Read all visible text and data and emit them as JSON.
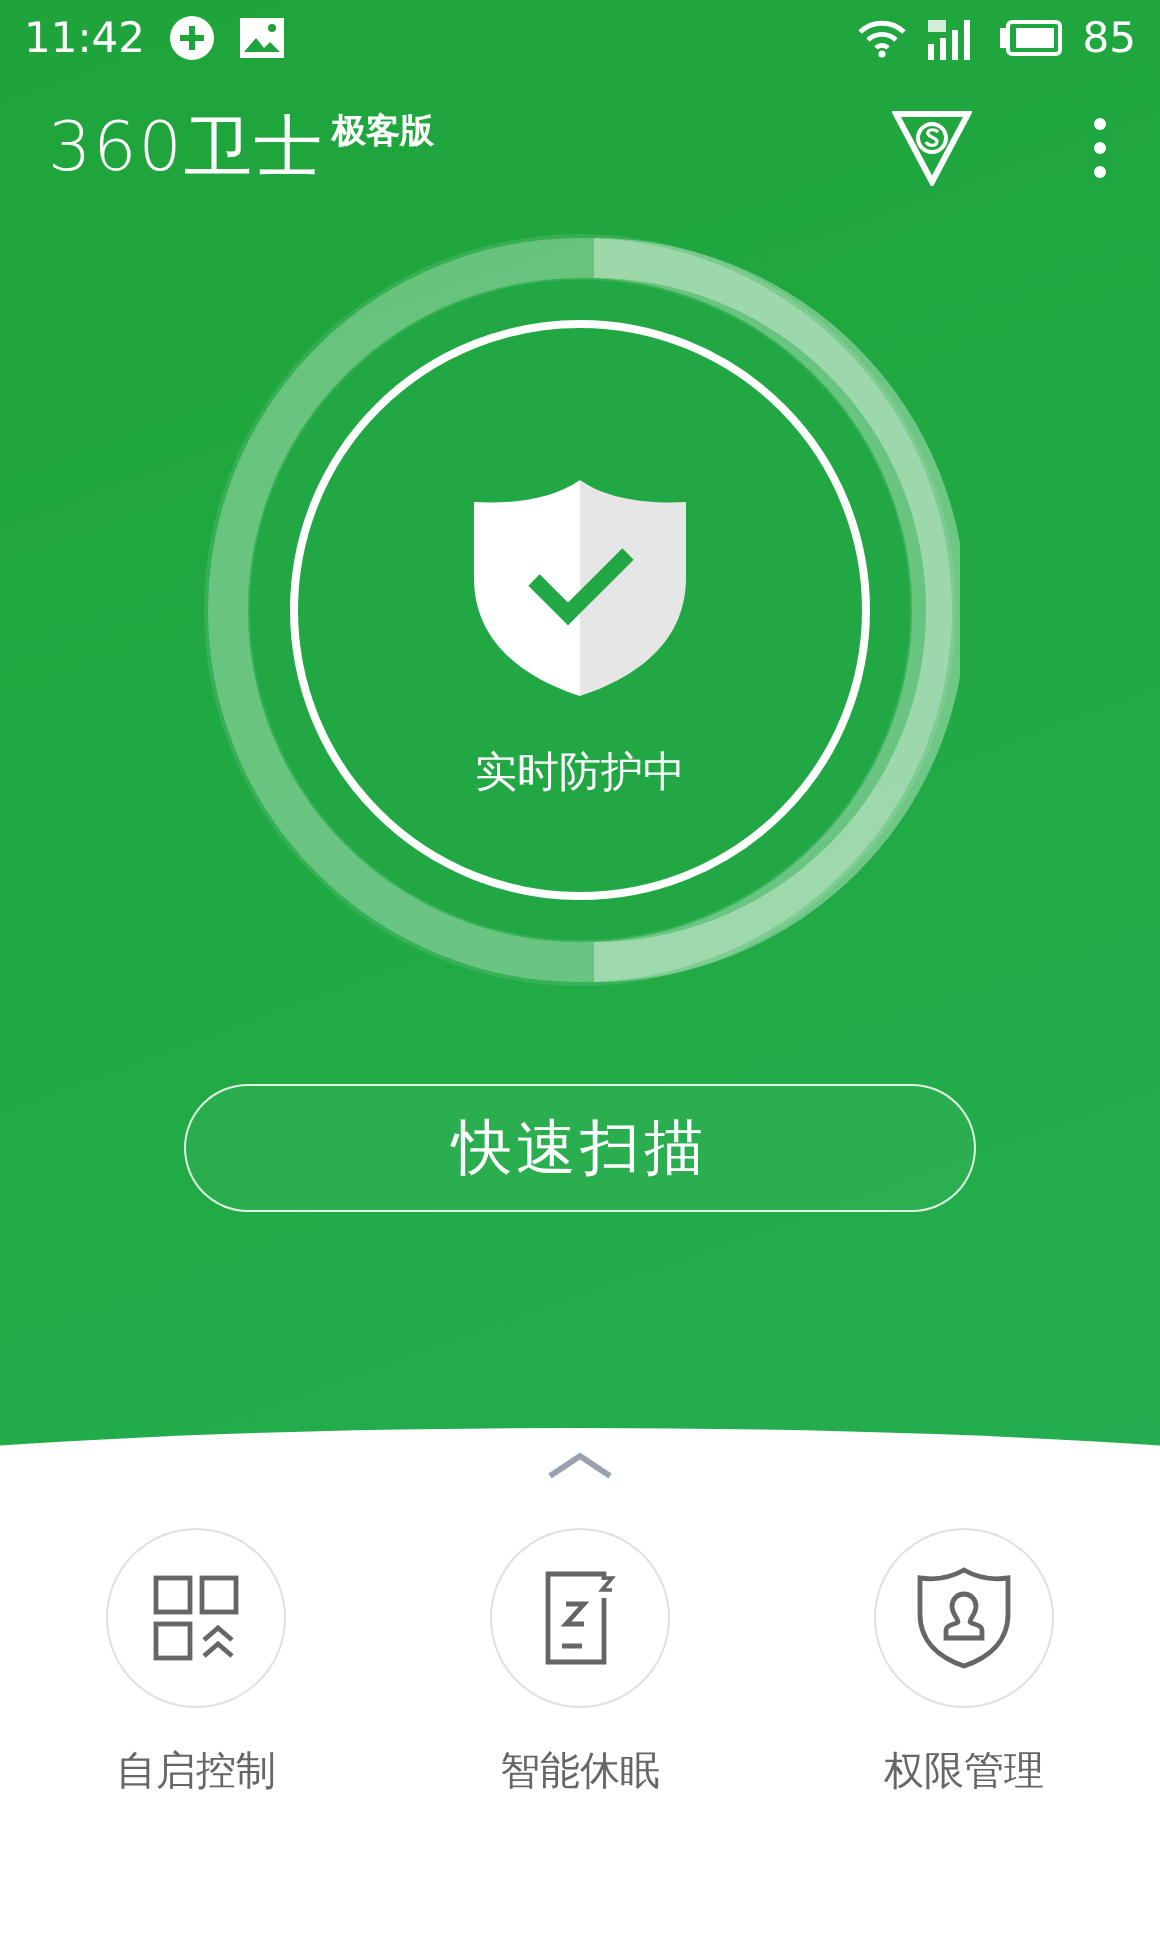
{
  "status_bar": {
    "time": "11:42",
    "battery": "85"
  },
  "app_bar": {
    "logo": "360卫士",
    "edition": "极客版"
  },
  "protection": {
    "status": "实时防护中"
  },
  "scan_button": {
    "label": "快速扫描"
  },
  "tools": [
    {
      "kind": "autostart",
      "label": "自启控制"
    },
    {
      "kind": "sleep",
      "label": "智能休眠"
    },
    {
      "kind": "permission",
      "label": "权限管理"
    }
  ]
}
